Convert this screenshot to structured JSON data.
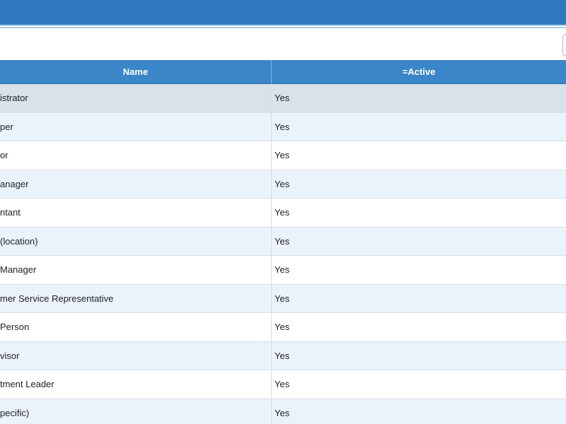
{
  "header": {
    "columns": {
      "name": "Name",
      "active": "=Active"
    }
  },
  "rows": [
    {
      "name": "istrator",
      "active": "Yes",
      "selected": true
    },
    {
      "name": "per",
      "active": "Yes"
    },
    {
      "name": "or",
      "active": "Yes"
    },
    {
      "name": "anager",
      "active": "Yes"
    },
    {
      "name": "ntant",
      "active": "Yes"
    },
    {
      "name": "(location)",
      "active": "Yes"
    },
    {
      "name": "Manager",
      "active": "Yes"
    },
    {
      "name": "mer Service Representative",
      "active": "Yes"
    },
    {
      "name": "Person",
      "active": "Yes"
    },
    {
      "name": "visor",
      "active": "Yes"
    },
    {
      "name": "tment Leader",
      "active": "Yes"
    },
    {
      "name": "pecific)",
      "active": "Yes"
    }
  ],
  "colors": {
    "titlebar": "#2f78bd",
    "header": "#3a86c8",
    "row_alt": "#eaf2fb",
    "row_selected": "#d9e1ea"
  }
}
